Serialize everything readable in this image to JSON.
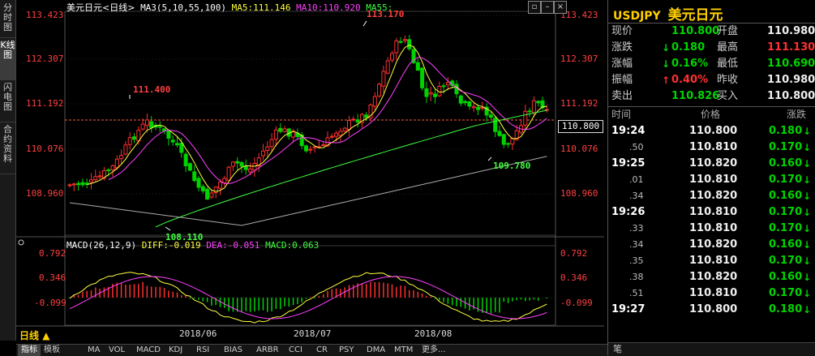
{
  "left_tabs": [
    "分时图",
    "K线图",
    "闪电图",
    "合约资料"
  ],
  "chart": {
    "title": "美元日元<日线>",
    "ma_legend": {
      "ma3": "MA3(5,10,55,100)",
      "ma5": "MA5:111.146",
      "ma10": "MA10:110.920",
      "ma55": "MA55:"
    },
    "price_labels": [
      "113.423",
      "112.307",
      "111.192",
      "110.076",
      "108.960"
    ],
    "right_price_labels": [
      "113.423",
      "112.307",
      "111.192",
      "110.076",
      "108.960"
    ],
    "current_price_tag": "110.800",
    "annotations": {
      "high": "113.170",
      "left_high": "111.400",
      "low": "108.110",
      "recent_low": "109.780"
    },
    "macd_legend": {
      "name": "MACD(26,12,9)",
      "diff": "DIFF:-0.019",
      "dea": "DEA:-0.051",
      "macd": "MACD:0.063"
    },
    "macd_labels": [
      "0.792",
      "0.346",
      "-0.099"
    ],
    "date_labels": [
      "2018/06",
      "2018/07",
      "2018/08"
    ],
    "period_label": "日线"
  },
  "bottom_tabs": [
    "指标",
    "模板",
    "MA",
    "VOL",
    "MACD",
    "KDJ",
    "RSI",
    "BIAS",
    "ARBR",
    "CCI",
    "CR",
    "PSY",
    "DMA",
    "MTM",
    "更多..."
  ],
  "quote": {
    "symbol": "USDJPY",
    "name": "美元日元",
    "rows": [
      {
        "l1": "现价",
        "v1": "110.800",
        "l2": "开盘",
        "v2": "110.980"
      },
      {
        "l1": "涨跌",
        "v1": "0.180",
        "l2": "最高",
        "v2": "111.130"
      },
      {
        "l1": "涨幅",
        "v1": "0.16%",
        "l2": "最低",
        "v2": "110.690"
      },
      {
        "l1": "振幅",
        "v1": "0.40%",
        "l2": "昨收",
        "v2": "110.980"
      },
      {
        "l1": "卖出",
        "v1": "110.826",
        "l2": "买入",
        "v2": "110.800"
      }
    ],
    "tick_headers": {
      "time": "时间",
      "price": "价格",
      "change": "涨跌"
    },
    "ticks": [
      {
        "time": "19:24",
        "price": "110.800",
        "change": "0.180"
      },
      {
        "time": ".50",
        "price": "110.810",
        "change": "0.170"
      },
      {
        "time": "19:25",
        "price": "110.820",
        "change": "0.160"
      },
      {
        "time": ".01",
        "price": "110.810",
        "change": "0.170"
      },
      {
        "time": ".34",
        "price": "110.820",
        "change": "0.160"
      },
      {
        "time": "19:26",
        "price": "110.810",
        "change": "0.170"
      },
      {
        "time": ".33",
        "price": "110.810",
        "change": "0.170"
      },
      {
        "time": ".34",
        "price": "110.820",
        "change": "0.160"
      },
      {
        "time": ".35",
        "price": "110.810",
        "change": "0.170"
      },
      {
        "time": ".38",
        "price": "110.820",
        "change": "0.160"
      },
      {
        "time": ".51",
        "price": "110.810",
        "change": "0.170"
      },
      {
        "time": "19:27",
        "price": "110.800",
        "change": "0.180"
      }
    ],
    "footer": "笔"
  },
  "colors": {
    "up": "#ff3030",
    "down": "#00d400",
    "ma5": "#ffff40",
    "ma10": "#ff40ff",
    "ma55": "#40ff40",
    "ma100": "#aaaaaa"
  }
}
